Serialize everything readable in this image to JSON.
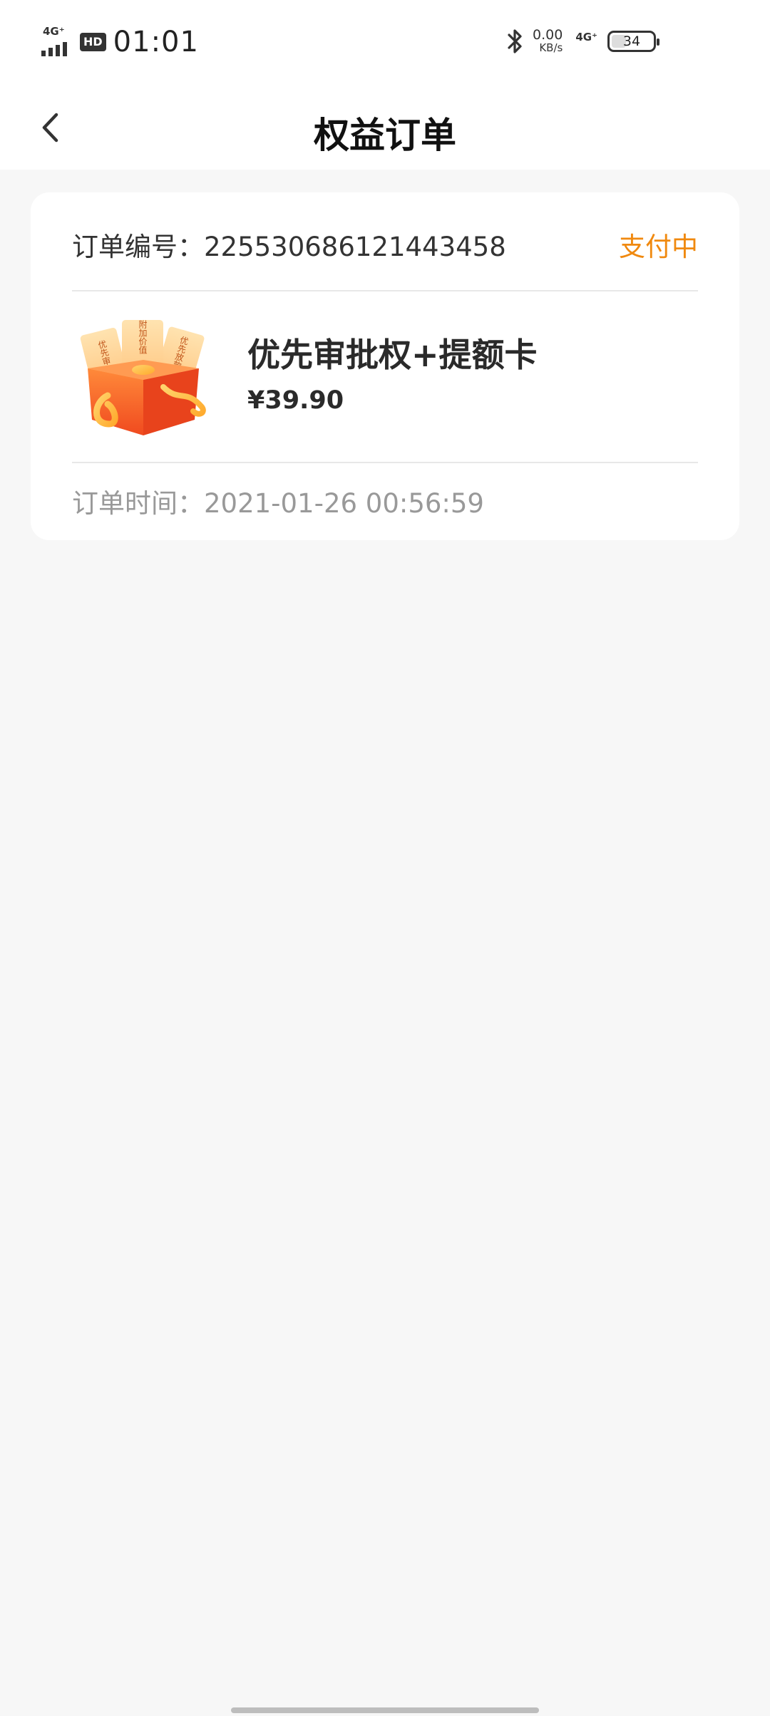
{
  "status_bar": {
    "network_type": "4G⁺",
    "hd_badge": "HD",
    "time": "01:01",
    "speed_value": "0.00",
    "speed_unit": "KB/s",
    "network_type_2": "4G⁺",
    "battery_level": "34"
  },
  "header": {
    "title": "权益订单"
  },
  "order": {
    "number_text": "订单编号：225530686121443458",
    "status": "支付中",
    "product_name": "优先审批权+提额卡",
    "price": "¥39.90",
    "time_text": "订单时间：2021-01-26 00:56:59",
    "status_color": "#f0890f"
  },
  "product_image": {
    "card_left": "优先审",
    "card_center": "附加价值",
    "card_right": "优先放款"
  },
  "icons": [
    "signal-icon",
    "bluetooth-icon",
    "battery-icon",
    "back-arrow-icon",
    "gift-box-icon"
  ]
}
